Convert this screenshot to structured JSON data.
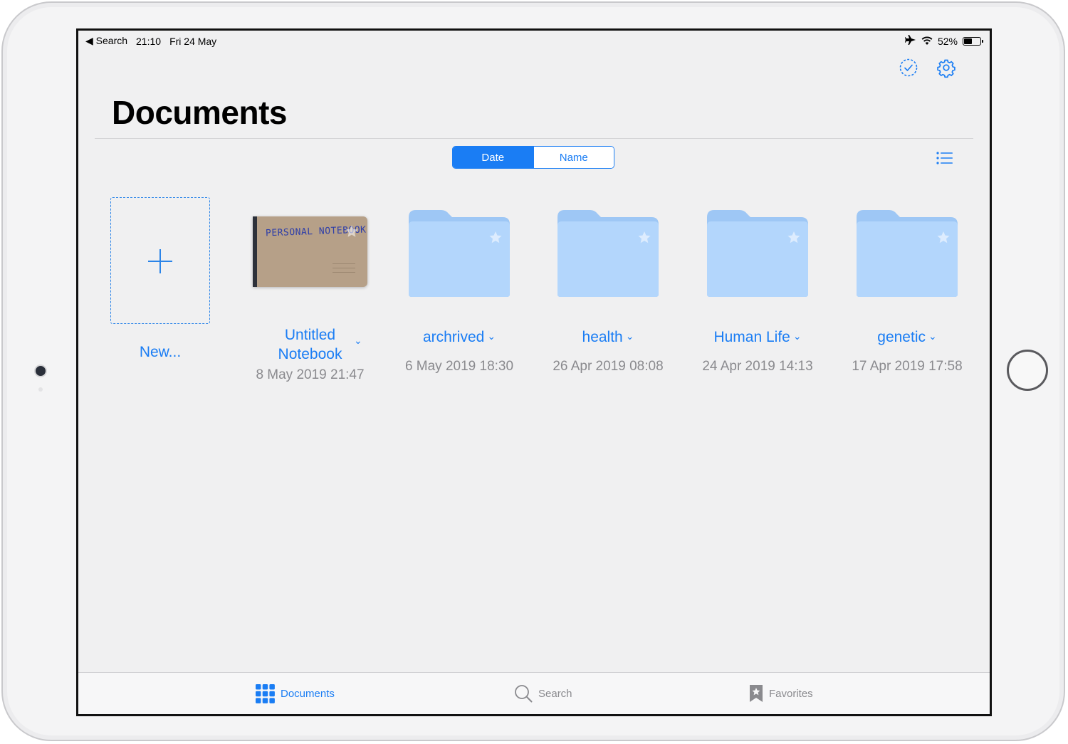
{
  "status_bar": {
    "back_label": "◀ Search",
    "time": "21:10",
    "date": "Fri 24 May",
    "battery": "52%",
    "battery_level": 0.52
  },
  "header": {
    "select_icon": "checkmark-circle-icon",
    "settings_icon": "gear-icon",
    "title": "Documents"
  },
  "sort": {
    "options": [
      "Date",
      "Name"
    ],
    "selected": "Date",
    "view_icon": "list-view-icon"
  },
  "new_item": {
    "label": "New..."
  },
  "items": [
    {
      "type": "notebook",
      "name_line1": "Untitled",
      "name_line2": "Notebook",
      "date": "8 May 2019 21:47",
      "cover_text": "PERSONAL NOTEBOOK"
    },
    {
      "type": "folder",
      "name": "archrived",
      "date": "6 May 2019 18:30"
    },
    {
      "type": "folder",
      "name": "health",
      "date": "26 Apr 2019 08:08"
    },
    {
      "type": "folder",
      "name": "Human Life",
      "date": "24 Apr 2019 14:13"
    },
    {
      "type": "folder",
      "name": "genetic",
      "date": "17 Apr 2019 17:58"
    }
  ],
  "tabbar": {
    "tabs": [
      {
        "label": "Documents",
        "icon": "grid-icon",
        "active": true
      },
      {
        "label": "Search",
        "icon": "search-icon",
        "active": false
      },
      {
        "label": "Favorites",
        "icon": "bookmark-star-icon",
        "active": false
      }
    ]
  },
  "colors": {
    "accent": "#1a7df4",
    "folder_light": "#b3d6fc",
    "folder_tab": "#9ec7f5",
    "notebook_cover": "#b6a088",
    "secondary_text": "#8a8a8e"
  }
}
